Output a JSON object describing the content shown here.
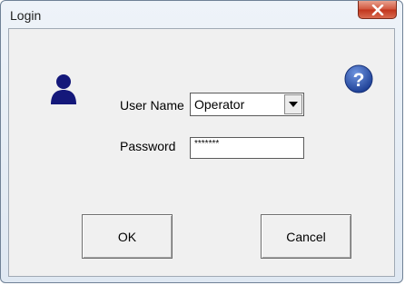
{
  "window": {
    "title": "Login",
    "close_icon": "close-icon"
  },
  "form": {
    "user_icon": "user-icon",
    "help_icon": "help-icon",
    "username_label": "User Name",
    "username_value": "Operator",
    "password_label": "Password",
    "password_value": "*******"
  },
  "buttons": {
    "ok_label": "OK",
    "cancel_label": "Cancel"
  },
  "colors": {
    "user_icon": "#14187a",
    "help_icon": "#2a4fa6",
    "close_button": "#c9432a"
  }
}
